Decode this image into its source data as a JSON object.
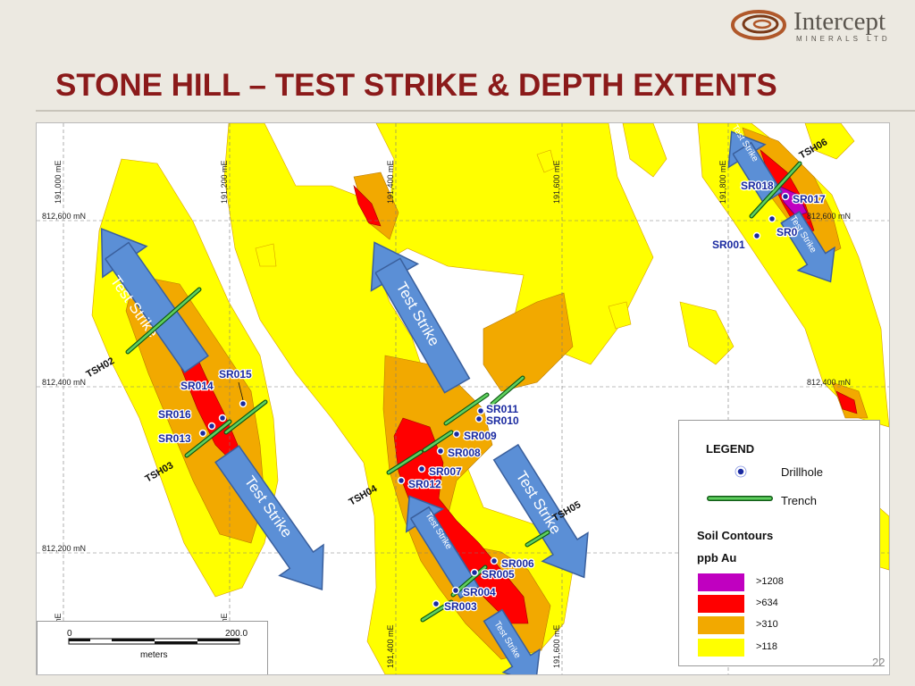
{
  "slide": {
    "title": "STONE HILL – TEST STRIKE & DEPTH EXTENTS",
    "page_number": "22"
  },
  "logo": {
    "name": "Intercept",
    "subtitle": "MINERALS LTD"
  },
  "map": {
    "grid_easting_labels": [
      "191,000 mE",
      "191,200 mE",
      "191,400 mE",
      "191,600 mE",
      "191,800 mE"
    ],
    "grid_easting_labels_bottom": [
      "mE",
      "mE",
      "191,400 mE",
      "191,600 mE"
    ],
    "grid_northing_labels_left": [
      "812,600 mN",
      "812,400 mN",
      "812,200 mN"
    ],
    "grid_northing_labels_right": [
      "812,600 mN",
      "812,400 mN"
    ],
    "drillholes": [
      "SR001",
      "SR003",
      "SR004",
      "SR005",
      "SR006",
      "SR007",
      "SR008",
      "SR009",
      "SR010",
      "SR011",
      "SR012",
      "SR013",
      "SR014",
      "SR015",
      "SR016",
      "SR017",
      "SR018",
      "SR002"
    ],
    "drillhole_labels_visible": {
      "SR018": "SR018",
      "SR002": "SR0"
    },
    "trenches": [
      "TSH02",
      "TSH03",
      "TSH04",
      "TSH05",
      "TSH06"
    ],
    "arrow_label": "Test Strike",
    "colors": {
      "contour_1208": "#c000c0",
      "contour_634": "#ff0000",
      "contour_310": "#f2a900",
      "contour_118": "#ffff00",
      "arrow_fill": "#5b8fd6",
      "arrow_stroke": "#3a5f9c",
      "trench": "#22a02a",
      "drillhole": "#1a2aa0",
      "label_text": "#1a2aa0"
    }
  },
  "legend": {
    "title": "LEGEND",
    "drillhole_label": "Drillhole",
    "trench_label": "Trench",
    "soil_heading": "Soil Contours",
    "soil_units": "ppb Au",
    "classes": [
      ">1208",
      ">634",
      ">310",
      ">118"
    ]
  },
  "scalebar": {
    "start": "0",
    "end": "200.0",
    "unit": "meters"
  }
}
